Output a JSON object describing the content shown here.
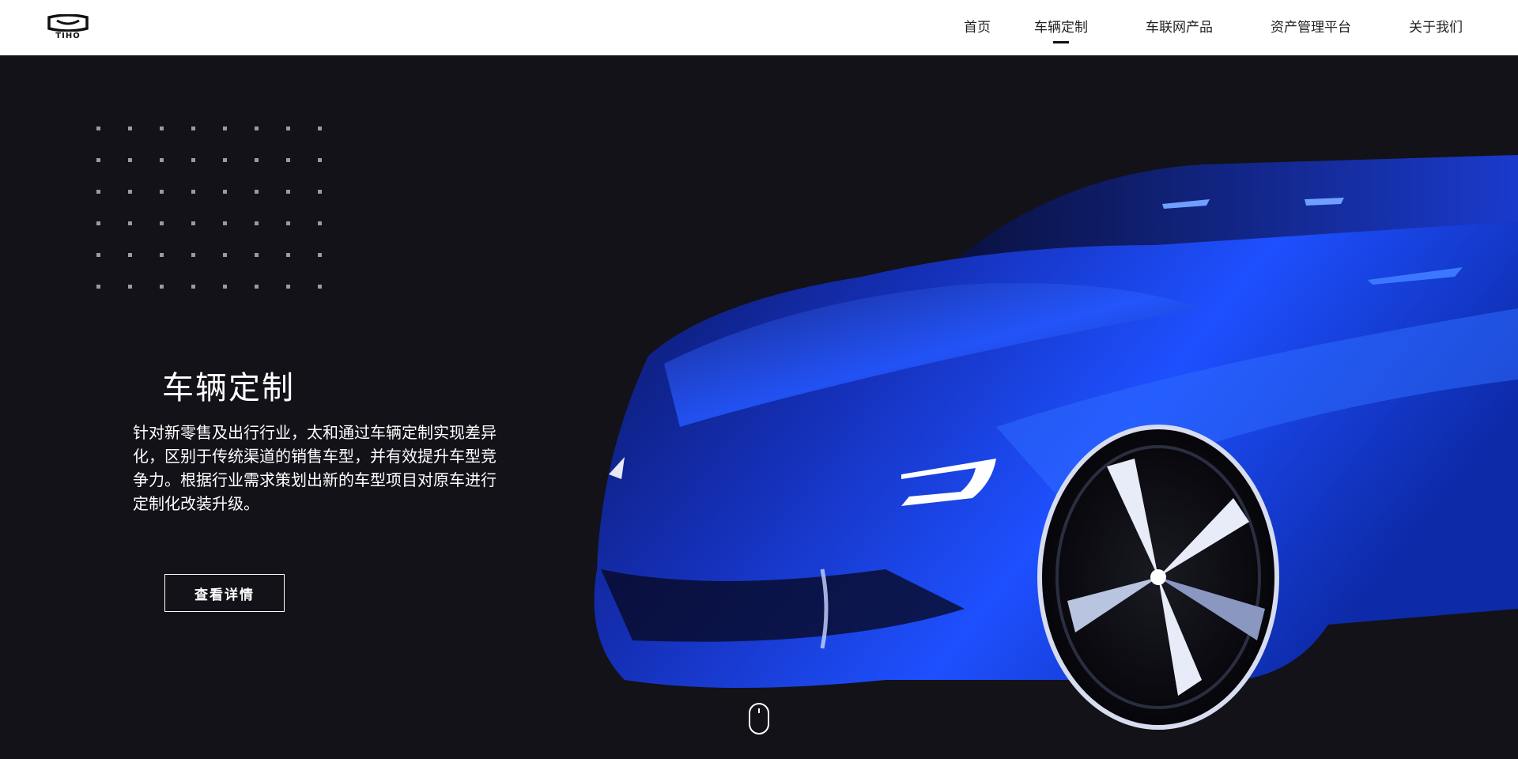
{
  "brand": {
    "logo_text": "TIHO"
  },
  "nav": {
    "items": [
      {
        "label": "首页",
        "active": false
      },
      {
        "label": "车辆定制",
        "active": true
      },
      {
        "label": "车联网产品",
        "active": false
      },
      {
        "label": "资产管理平台",
        "active": false
      },
      {
        "label": "关于我们",
        "active": false
      }
    ]
  },
  "hero": {
    "title": "车辆定制",
    "description": "针对新零售及出行行业，太和通过车辆定制实现差异化，区别于传统渠道的销售车型，并有效提升车型竞争力。根据行业需求策划出新的车型项目对原车进行定制化改装升级。",
    "button_label": "查看详情",
    "image": "blue-concept-car-icon",
    "scroll_hint": "mouse-scroll-icon"
  },
  "colors": {
    "background": "#121218",
    "topbar": "#ffffff",
    "accent_blue": "#1e50ff",
    "text_light": "#ffffff",
    "text_dark": "#222222"
  }
}
